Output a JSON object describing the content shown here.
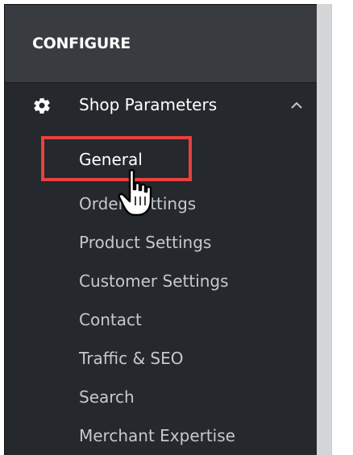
{
  "section": {
    "title": "CONFIGURE"
  },
  "menu": {
    "parent": {
      "label": "Shop Parameters",
      "icon": "gear-icon",
      "expanded_icon": "chevron-up-icon"
    },
    "items": [
      {
        "label": "General",
        "active": true
      },
      {
        "label": "Order Settings",
        "active": false
      },
      {
        "label": "Product Settings",
        "active": false
      },
      {
        "label": "Customer Settings",
        "active": false
      },
      {
        "label": "Contact",
        "active": false
      },
      {
        "label": "Traffic & SEO",
        "active": false
      },
      {
        "label": "Search",
        "active": false
      },
      {
        "label": "Merchant Expertise",
        "active": false
      }
    ]
  },
  "annotation": {
    "highlight_color": "#e8413f",
    "cursor_icon": "hand-cursor-icon"
  },
  "colors": {
    "sidebar_bg": "#25282c",
    "header_bg": "#383b40",
    "text_active": "#ffffff",
    "text_inactive": "#c6c9cc"
  }
}
